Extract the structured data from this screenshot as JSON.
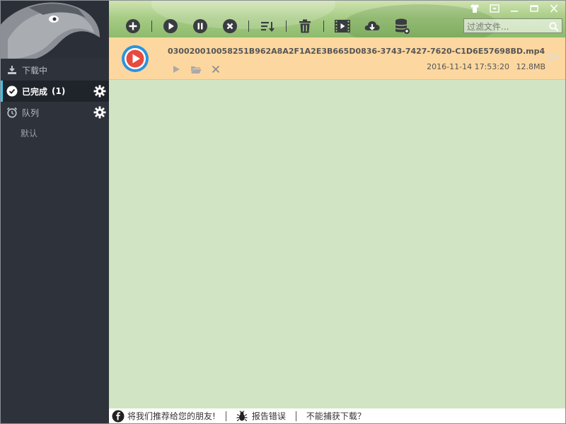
{
  "sidebar": {
    "downloading_label": "下载中",
    "completed_label": "已完成",
    "completed_count": "(1)",
    "queue_label": "队列",
    "queue_default_label": "默认"
  },
  "toolbar": {
    "icons": [
      "add-icon",
      "play-icon",
      "pause-icon",
      "stop-icon",
      "sort-icon",
      "delete-icon",
      "video-icon",
      "cloud-download-icon",
      "database-icon"
    ]
  },
  "search": {
    "placeholder": "过滤文件..."
  },
  "downloads": [
    {
      "filename": "030020010058251B962A8A2F1A2E3B665D0836-3743-7427-7620-C1D6E57698BD.mp4",
      "date": "2016-11-14 17:53:20",
      "size": "12.8MB"
    }
  ],
  "footer": {
    "recommend_label": "将我们推荐给您的朋友!",
    "report_label": "报告错误",
    "cant_capture_label": "不能捕获下载？"
  },
  "colors": {
    "sidebar": "#2e333b",
    "accent": "#3cc3e8",
    "row_highlight": "#fcd79f",
    "content_bg": "#d1e4c3"
  }
}
